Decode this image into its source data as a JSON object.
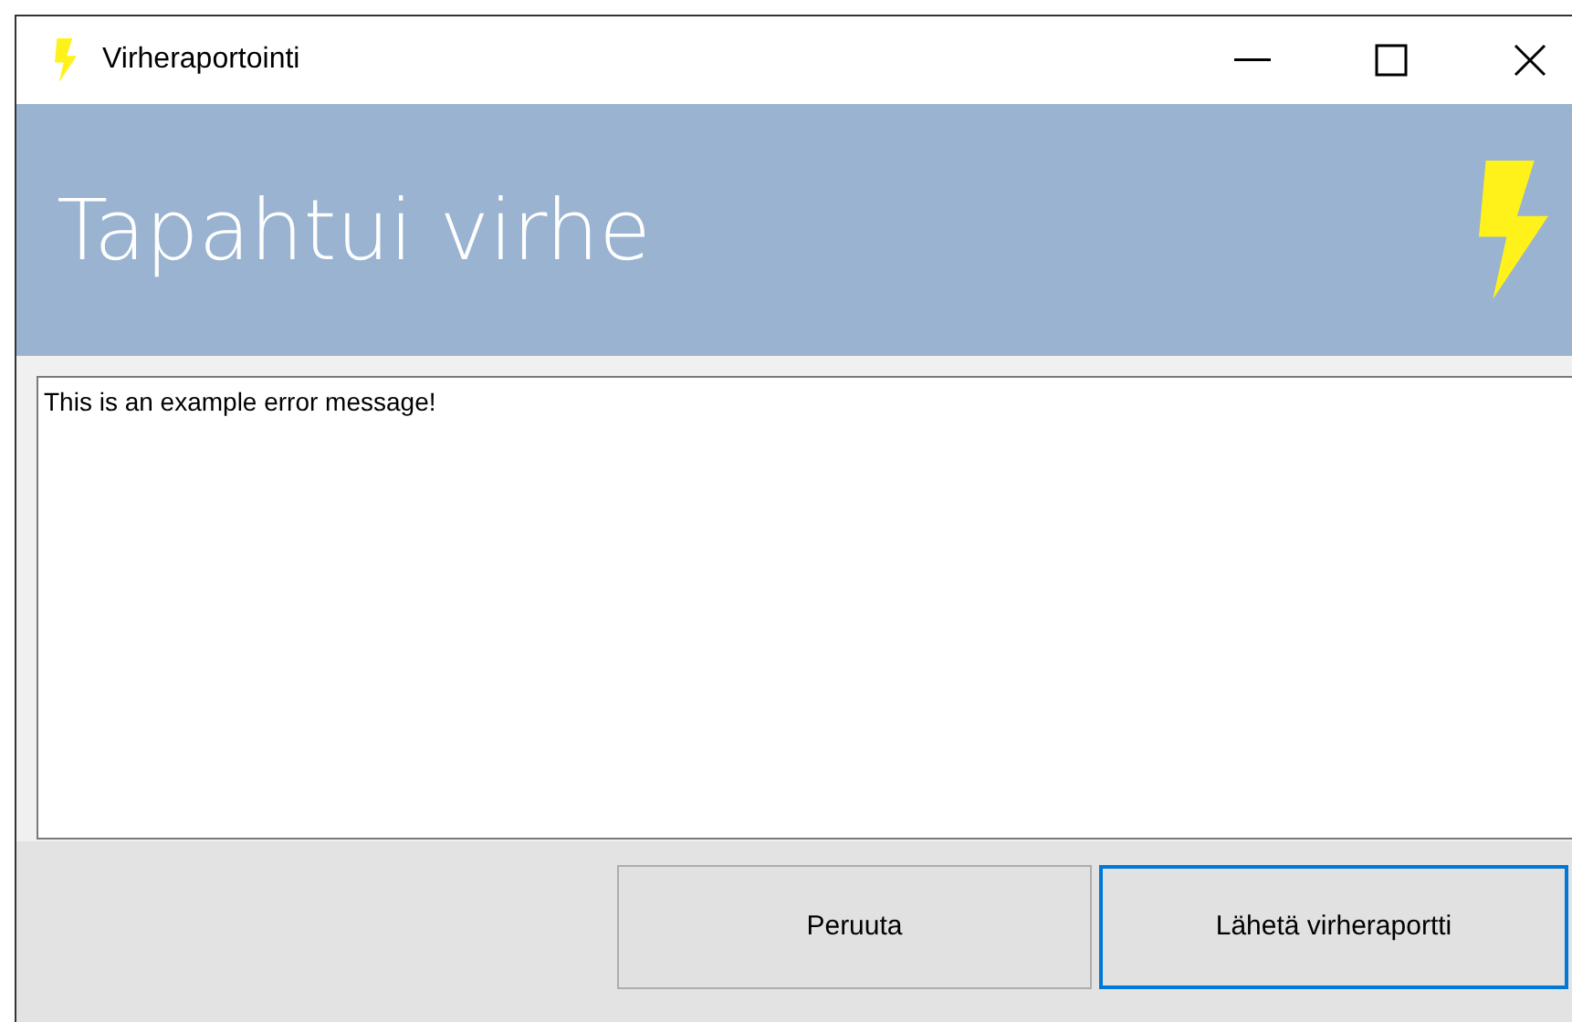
{
  "window": {
    "title": "Virheraportointi"
  },
  "header": {
    "title": "Tapahtui virhe"
  },
  "message": {
    "value": "This is an example error message!"
  },
  "buttons": [
    {
      "label": "Peruuta",
      "focused": false
    },
    {
      "label": "Lähetä virheraportti",
      "focused": true
    }
  ]
}
